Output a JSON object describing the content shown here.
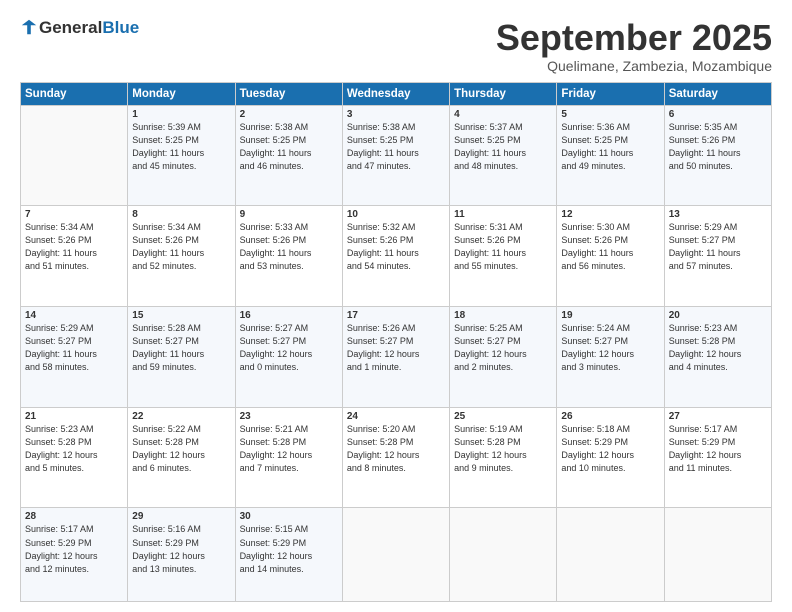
{
  "logo": {
    "general": "General",
    "blue": "Blue"
  },
  "header": {
    "month": "September 2025",
    "location": "Quelimane, Zambezia, Mozambique"
  },
  "weekdays": [
    "Sunday",
    "Monday",
    "Tuesday",
    "Wednesday",
    "Thursday",
    "Friday",
    "Saturday"
  ],
  "weeks": [
    [
      {
        "day": "",
        "info": ""
      },
      {
        "day": "1",
        "info": "Sunrise: 5:39 AM\nSunset: 5:25 PM\nDaylight: 11 hours\nand 45 minutes."
      },
      {
        "day": "2",
        "info": "Sunrise: 5:38 AM\nSunset: 5:25 PM\nDaylight: 11 hours\nand 46 minutes."
      },
      {
        "day": "3",
        "info": "Sunrise: 5:38 AM\nSunset: 5:25 PM\nDaylight: 11 hours\nand 47 minutes."
      },
      {
        "day": "4",
        "info": "Sunrise: 5:37 AM\nSunset: 5:25 PM\nDaylight: 11 hours\nand 48 minutes."
      },
      {
        "day": "5",
        "info": "Sunrise: 5:36 AM\nSunset: 5:25 PM\nDaylight: 11 hours\nand 49 minutes."
      },
      {
        "day": "6",
        "info": "Sunrise: 5:35 AM\nSunset: 5:26 PM\nDaylight: 11 hours\nand 50 minutes."
      }
    ],
    [
      {
        "day": "7",
        "info": "Sunrise: 5:34 AM\nSunset: 5:26 PM\nDaylight: 11 hours\nand 51 minutes."
      },
      {
        "day": "8",
        "info": "Sunrise: 5:34 AM\nSunset: 5:26 PM\nDaylight: 11 hours\nand 52 minutes."
      },
      {
        "day": "9",
        "info": "Sunrise: 5:33 AM\nSunset: 5:26 PM\nDaylight: 11 hours\nand 53 minutes."
      },
      {
        "day": "10",
        "info": "Sunrise: 5:32 AM\nSunset: 5:26 PM\nDaylight: 11 hours\nand 54 minutes."
      },
      {
        "day": "11",
        "info": "Sunrise: 5:31 AM\nSunset: 5:26 PM\nDaylight: 11 hours\nand 55 minutes."
      },
      {
        "day": "12",
        "info": "Sunrise: 5:30 AM\nSunset: 5:26 PM\nDaylight: 11 hours\nand 56 minutes."
      },
      {
        "day": "13",
        "info": "Sunrise: 5:29 AM\nSunset: 5:27 PM\nDaylight: 11 hours\nand 57 minutes."
      }
    ],
    [
      {
        "day": "14",
        "info": "Sunrise: 5:29 AM\nSunset: 5:27 PM\nDaylight: 11 hours\nand 58 minutes."
      },
      {
        "day": "15",
        "info": "Sunrise: 5:28 AM\nSunset: 5:27 PM\nDaylight: 11 hours\nand 59 minutes."
      },
      {
        "day": "16",
        "info": "Sunrise: 5:27 AM\nSunset: 5:27 PM\nDaylight: 12 hours\nand 0 minutes."
      },
      {
        "day": "17",
        "info": "Sunrise: 5:26 AM\nSunset: 5:27 PM\nDaylight: 12 hours\nand 1 minute."
      },
      {
        "day": "18",
        "info": "Sunrise: 5:25 AM\nSunset: 5:27 PM\nDaylight: 12 hours\nand 2 minutes."
      },
      {
        "day": "19",
        "info": "Sunrise: 5:24 AM\nSunset: 5:27 PM\nDaylight: 12 hours\nand 3 minutes."
      },
      {
        "day": "20",
        "info": "Sunrise: 5:23 AM\nSunset: 5:28 PM\nDaylight: 12 hours\nand 4 minutes."
      }
    ],
    [
      {
        "day": "21",
        "info": "Sunrise: 5:23 AM\nSunset: 5:28 PM\nDaylight: 12 hours\nand 5 minutes."
      },
      {
        "day": "22",
        "info": "Sunrise: 5:22 AM\nSunset: 5:28 PM\nDaylight: 12 hours\nand 6 minutes."
      },
      {
        "day": "23",
        "info": "Sunrise: 5:21 AM\nSunset: 5:28 PM\nDaylight: 12 hours\nand 7 minutes."
      },
      {
        "day": "24",
        "info": "Sunrise: 5:20 AM\nSunset: 5:28 PM\nDaylight: 12 hours\nand 8 minutes."
      },
      {
        "day": "25",
        "info": "Sunrise: 5:19 AM\nSunset: 5:28 PM\nDaylight: 12 hours\nand 9 minutes."
      },
      {
        "day": "26",
        "info": "Sunrise: 5:18 AM\nSunset: 5:29 PM\nDaylight: 12 hours\nand 10 minutes."
      },
      {
        "day": "27",
        "info": "Sunrise: 5:17 AM\nSunset: 5:29 PM\nDaylight: 12 hours\nand 11 minutes."
      }
    ],
    [
      {
        "day": "28",
        "info": "Sunrise: 5:17 AM\nSunset: 5:29 PM\nDaylight: 12 hours\nand 12 minutes."
      },
      {
        "day": "29",
        "info": "Sunrise: 5:16 AM\nSunset: 5:29 PM\nDaylight: 12 hours\nand 13 minutes."
      },
      {
        "day": "30",
        "info": "Sunrise: 5:15 AM\nSunset: 5:29 PM\nDaylight: 12 hours\nand 14 minutes."
      },
      {
        "day": "",
        "info": ""
      },
      {
        "day": "",
        "info": ""
      },
      {
        "day": "",
        "info": ""
      },
      {
        "day": "",
        "info": ""
      }
    ]
  ]
}
